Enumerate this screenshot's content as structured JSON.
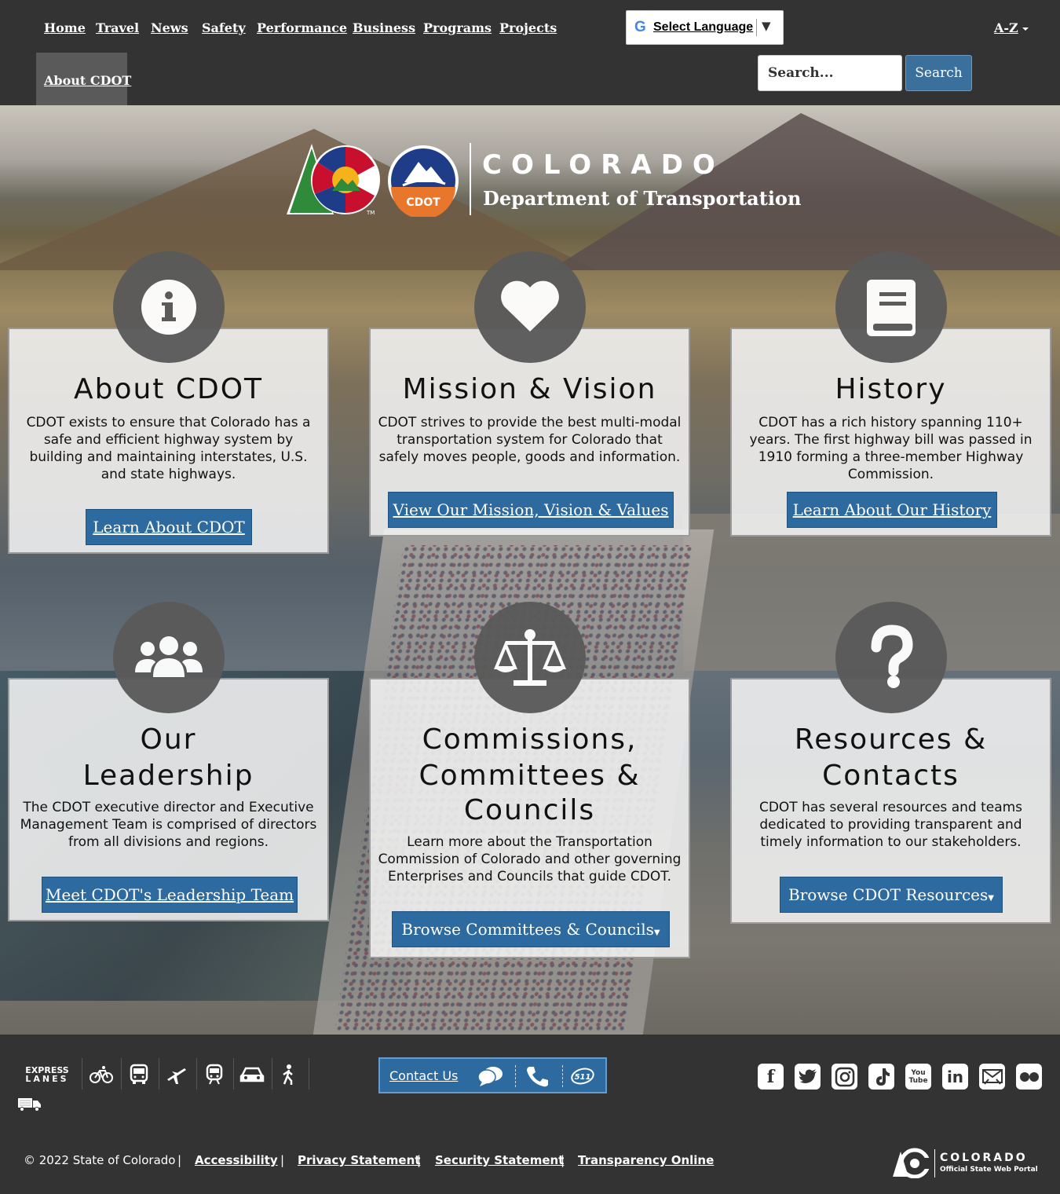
{
  "nav": {
    "items": [
      "Home",
      "Travel",
      "News",
      "Safety",
      "Performance",
      "Business",
      "Programs",
      "Projects"
    ],
    "active": "About CDOT",
    "language_label": "Select Language",
    "az_label": "A-Z",
    "search_placeholder": "Search...",
    "search_button": "Search"
  },
  "logo": {
    "title": "COLORADO",
    "subtitle": "Department of Transportation",
    "badge": "CDOT",
    "tm": "TM"
  },
  "cards": [
    {
      "icon": "info-icon",
      "title": "About CDOT",
      "text": "CDOT exists to ensure that Colorado has a safe and efficient highway system by building and maintaining interstates, U.S. and state highways.",
      "button": "Learn About CDOT"
    },
    {
      "icon": "heart-icon",
      "title": "Mission & Vision",
      "text": "CDOT strives to provide the best multi-modal transportation system for Colorado that safely moves people, goods and information.",
      "button": "View Our Mission, Vision & Values"
    },
    {
      "icon": "book-icon",
      "title": "History",
      "text": "CDOT has a rich history spanning 110+ years. The first highway bill was passed in 1910 forming a three-member Highway Commission.",
      "button": "Learn About Our History"
    },
    {
      "icon": "users-icon",
      "title_line1": "Our",
      "title_line2": "Leadership",
      "text": "The CDOT executive director and Executive Management Team is comprised of directors from all divisions and regions.",
      "button": "Meet CDOT's Leadership Team"
    },
    {
      "icon": "balance-scale-icon",
      "title_line1": "Commissions,",
      "title_line2": "Committees &",
      "title_line3": "Councils",
      "text": "Learn more about the Transportation Commission of Colorado and other governing Enterprises and Councils that guide CDOT.",
      "button": "Browse Committees & Councils"
    },
    {
      "icon": "question-icon",
      "title_line1": "Resources &",
      "title_line2": "Contacts",
      "text": "CDOT has several resources and teams dedicated to providing transparent and timely information to our stakeholders.",
      "button": "Browse CDOT Resources"
    }
  ],
  "footer": {
    "express_lanes_line1": "EXPRESS",
    "express_lanes_line2": "LANES",
    "contact_label": "Contact Us",
    "badge_511": "511",
    "social": [
      "f",
      "t",
      "ig",
      "tt",
      "You Tube",
      "in",
      "email",
      "flickr"
    ],
    "copyright": "© 2022 State of Colorado",
    "links": [
      "Accessibility",
      "Privacy Statement",
      "Security Statement",
      "Transparency Online"
    ],
    "separator": "|",
    "portal_title": "COLORADO",
    "portal_sub": "Official State Web Portal"
  },
  "colors": {
    "bar": "#333333",
    "button_blue": "#2d6a9f",
    "card_bg": "#f3f3f3",
    "icon_circle": "#5a5a5a"
  }
}
